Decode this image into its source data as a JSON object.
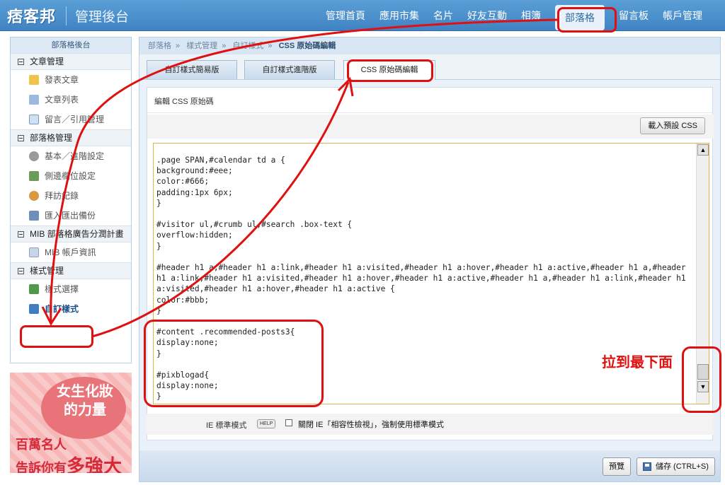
{
  "header": {
    "logo": "痞客邦",
    "subtitle": "管理後台",
    "nav": [
      "管理首頁",
      "應用市集",
      "名片",
      "好友互動",
      "相簿",
      "部落格",
      "留言板",
      "帳戶管理"
    ],
    "active_nav": "部落格"
  },
  "sidebar": {
    "title": "部落格後台",
    "sections": [
      {
        "label": "文章管理",
        "items": [
          "發表文章",
          "文章列表",
          "留言／引用管理"
        ]
      },
      {
        "label": "部落格管理",
        "items": [
          "基本／進階設定",
          "側邊欄位設定",
          "拜訪紀錄",
          "匯入匯出備份"
        ]
      },
      {
        "label": "MIB 部落格廣告分潤計畫",
        "items": [
          "MIB 帳戶資訊"
        ]
      },
      {
        "label": "樣式管理",
        "items": [
          "樣式選擇",
          "自訂樣式"
        ]
      }
    ],
    "current_item": "自訂樣式"
  },
  "ad": {
    "line1": "女生化妝",
    "line2": "的力量",
    "line3": "百萬名人",
    "line4a": "告訴你有",
    "line4b": "多強大"
  },
  "breadcrumb": [
    "部落格",
    "樣式管理",
    "自訂樣式",
    "CSS 原始碼編輯"
  ],
  "tabs": [
    "自訂樣式簡易版",
    "自訂樣式進階版",
    "CSS 原始碼編輯"
  ],
  "active_tab": "CSS 原始碼編輯",
  "panel": {
    "title": "編輯 CSS 原始碼",
    "load_default_button": "載入預設 CSS"
  },
  "editor": {
    "code": ".page SPAN,#calendar td a {\nbackground:#eee;\ncolor:#666;\npadding:1px 6px;\n}\n\n#visitor ul,#crumb ul,#search .box-text {\noverflow:hidden;\n}\n\n#header h1 a,#header h1 a:link,#header h1 a:visited,#header h1 a:hover,#header h1 a:active,#header h1 a,#header h1 a:link,#header h1 a:visited,#header h1 a:hover,#header h1 a:active,#header h1 a,#header h1 a:link,#header h1 a:visited,#header h1 a:hover,#header h1 a:active {\ncolor:#bbb;\n}\n\n#content .recommended-posts3{\ndisplay:none;\n}\n\n#pixblogad{\ndisplay:none;\n}"
  },
  "ie_mode": {
    "label": "IE 標準模式",
    "help": "HELP",
    "checkbox_text": "關閉 IE「相容性檢視」，強制使用標準模式",
    "checked": false
  },
  "buttons": {
    "preview": "預覽",
    "save": "儲存 (CTRL+S)"
  },
  "annotation": {
    "note": "拉到最下面",
    "color": "#e01010"
  },
  "colors": {
    "header_blue": "#4a8fcf",
    "editor_border": "#e0b44c"
  }
}
